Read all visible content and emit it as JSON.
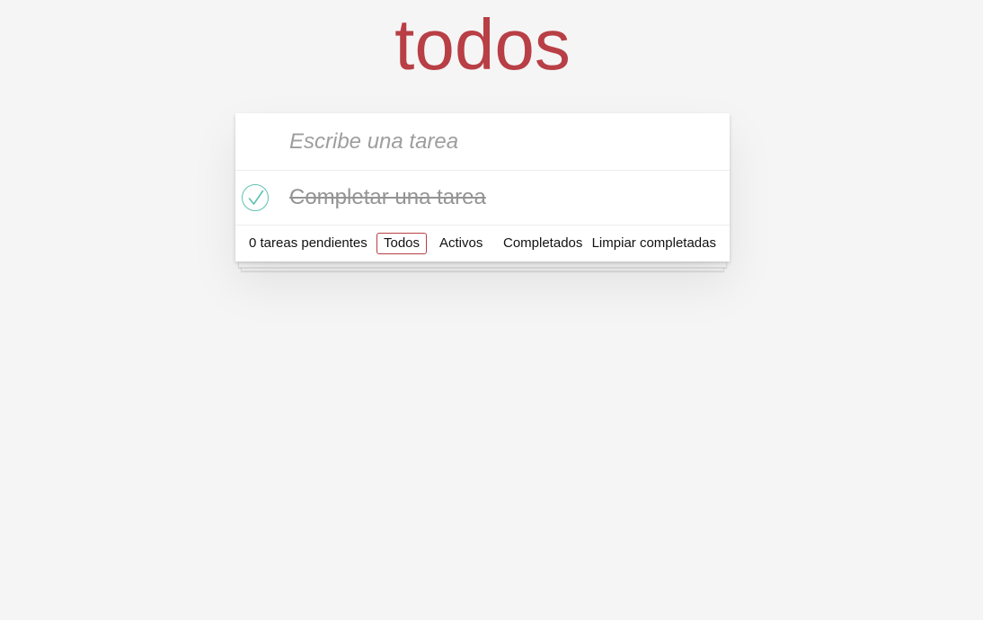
{
  "header": {
    "title": "todos",
    "title_color": "#b83f45"
  },
  "new_todo": {
    "placeholder": "Escribe una tarea",
    "value": ""
  },
  "todos": [
    {
      "label": "Completar una tarea",
      "completed": true,
      "toggle_icon": "check-icon"
    }
  ],
  "footer": {
    "count_text": "0 tareas pendientes",
    "filters": [
      {
        "label": "Todos",
        "selected": true
      },
      {
        "label": "Activos",
        "selected": false
      },
      {
        "label": "Completados",
        "selected": false
      }
    ],
    "clear_completed_label": "Limpiar completadas"
  },
  "colors": {
    "background": "#f5f5f5",
    "accent": "#b83f45",
    "check": "#5dc2af",
    "completed_text": "#949494"
  }
}
